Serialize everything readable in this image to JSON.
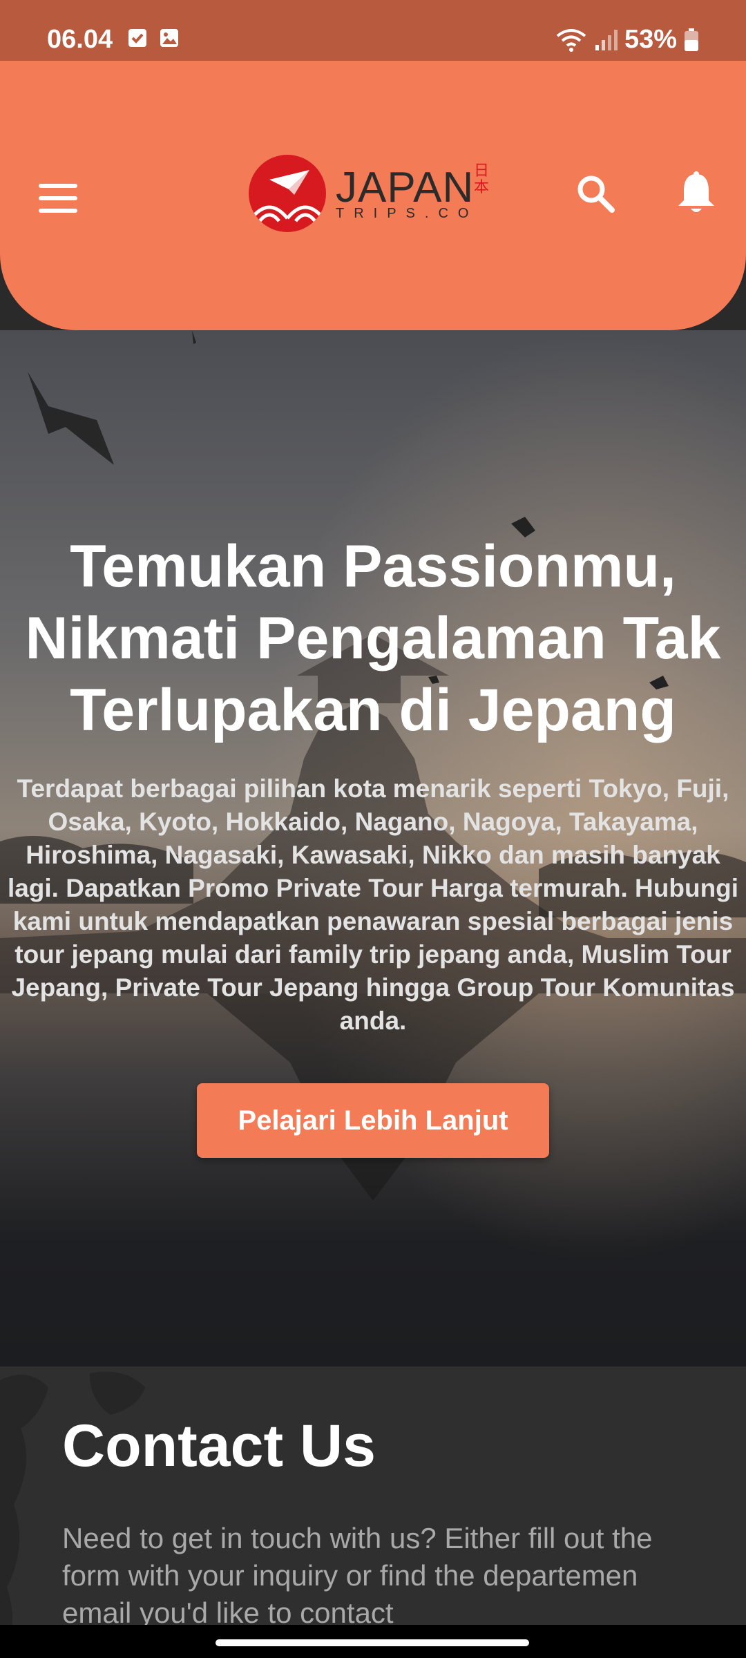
{
  "status_bar": {
    "time": "06.04",
    "battery": "53%"
  },
  "header": {
    "logo_title": "JAPAN",
    "logo_kanji": "日本",
    "logo_subtitle": "TRIPS.CO"
  },
  "hero": {
    "title": "Temukan Passionmu, Nikmati Pengalaman Tak Terlupakan di Jepang",
    "description": "Terdapat berbagai pilihan kota menarik seperti Tokyo, Fuji, Osaka, Kyoto, Hokkaido, Nagano, Nagoya, Takayama, Hiroshima, Nagasaki, Kawasaki, Nikko dan masih banyak lagi. Dapatkan Promo Private Tour Harga termurah. Hubungi kami untuk mendapatkan penawaran spesial berbagai jenis tour jepang mulai dari family trip jepang anda, Muslim Tour Jepang, Private Tour Jepang hingga Group Tour Komunitas anda.",
    "button_label": "Pelajari Lebih Lanjut"
  },
  "contact": {
    "title": "Contact Us",
    "description": "Need to get in touch with us? Either fill out the form with your inquiry or find the departemen email you'd like to contact"
  },
  "colors": {
    "accent": "#f37b56",
    "status_bar": "#b85a3e",
    "logo_red": "#d71920"
  }
}
